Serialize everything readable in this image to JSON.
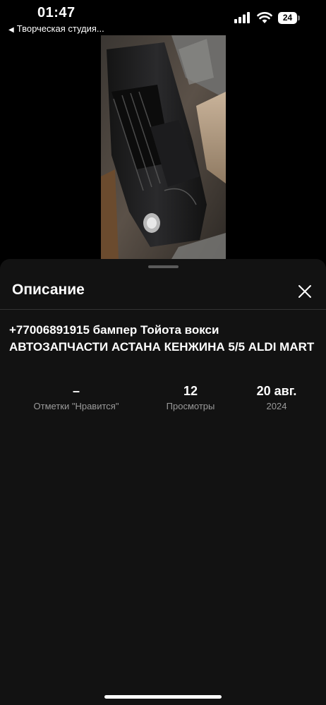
{
  "status_bar": {
    "time": "01:47",
    "back_label": "Творческая студия...",
    "battery": "24"
  },
  "photo": {
    "subject": "bumper photo"
  },
  "sheet": {
    "title": "Описание",
    "description": "+77006891915 бампер Тойота вокси АВТОЗАПЧАСТИ АСТАНА КЕНЖИНА 5/5 ALDI MART",
    "stats": {
      "likes_value": "–",
      "likes_label": "Отметки \"Нравится\"",
      "views_value": "12",
      "views_label": "Просмотры",
      "date_value": "20 авг.",
      "date_year": "2024"
    }
  },
  "colors": {
    "background": "#000000",
    "sheet": "#121212",
    "secondary_text": "#9a9a9a"
  }
}
